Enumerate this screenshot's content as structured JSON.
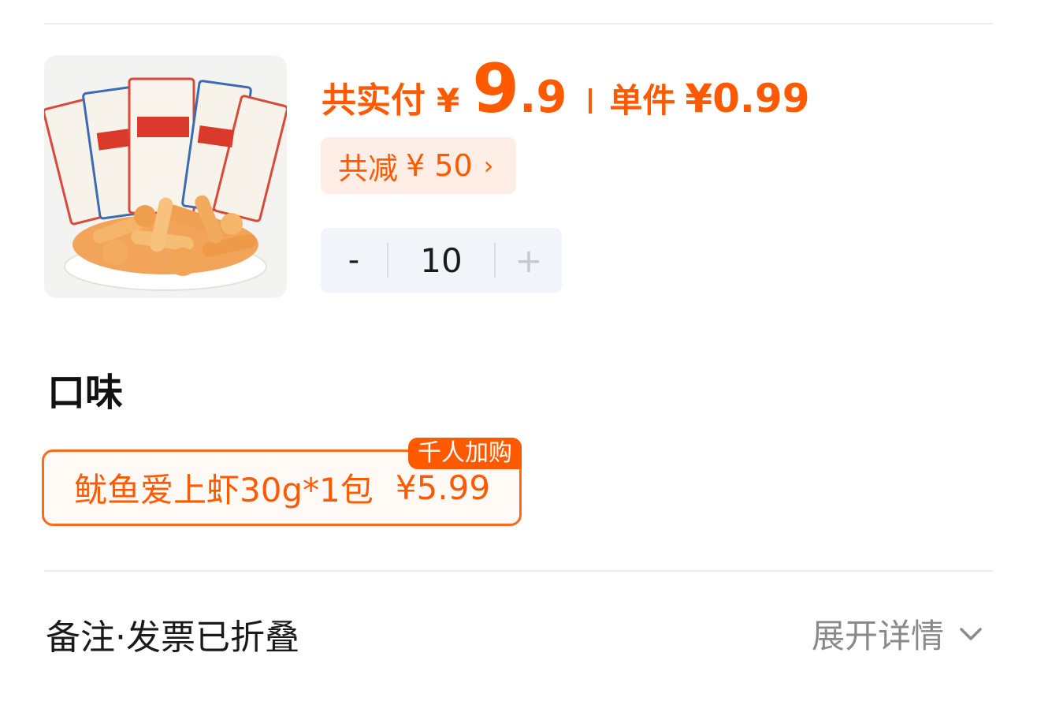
{
  "product": {
    "image_alt": "鱿鱼爱上虾",
    "image_label": "鱿鱼爱上虾"
  },
  "price": {
    "total_label": "共实付",
    "currency": "¥",
    "total_int": "9",
    "total_dec": ".9",
    "unit_label": "单件",
    "unit_price": "¥0.99"
  },
  "discount": {
    "label": "共减",
    "amount": "¥ 50",
    "chevron": "›"
  },
  "quantity": {
    "minus": "-",
    "value": "10",
    "plus": "+"
  },
  "flavor": {
    "title": "口味",
    "option": {
      "name": "鱿鱼爱上虾30g*1包",
      "price": "¥5.99",
      "badge": "千人加购",
      "selected": true
    }
  },
  "notes": {
    "label": "备注·发票已折叠",
    "expand_label": "展开详情",
    "expand_icon": "chevron-down-icon"
  },
  "colors": {
    "accent": "#ff5a00",
    "chip_bg": "#ffeee6",
    "stepper_bg": "#f1f4f8"
  }
}
